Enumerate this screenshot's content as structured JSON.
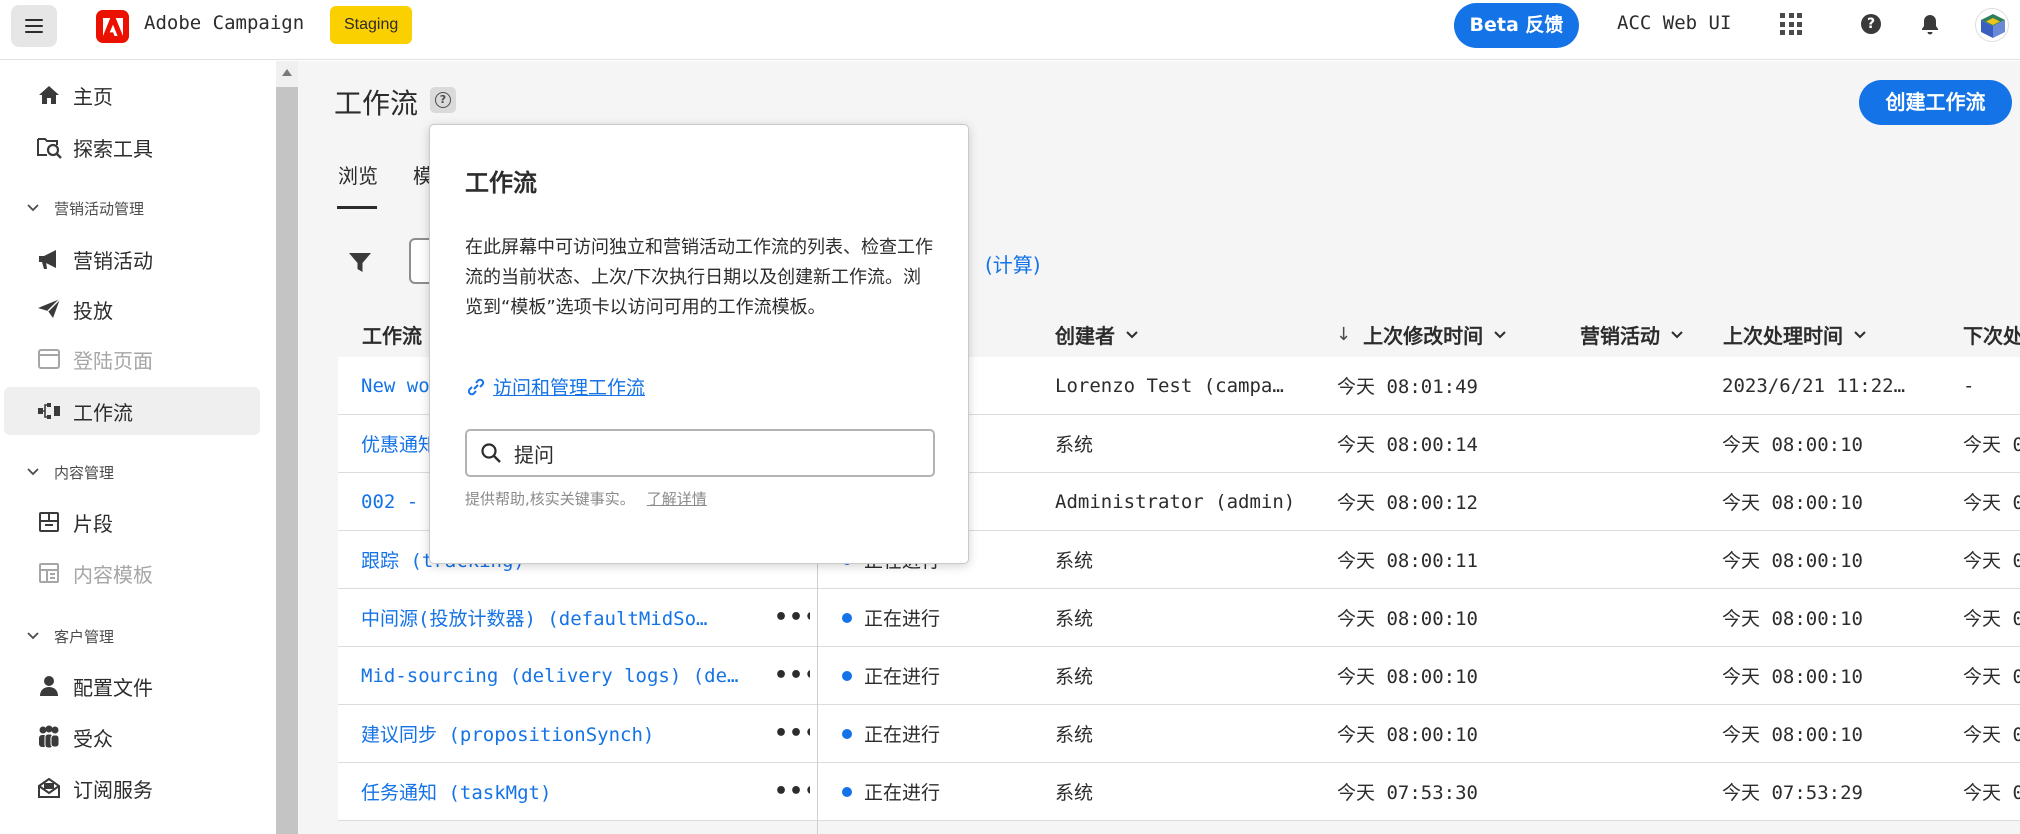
{
  "topbar": {
    "app_name": "Adobe Campaign",
    "env_badge": "Staging",
    "beta_label": "Beta 反馈",
    "org_name": "ACC Web UI",
    "help_glyph": "?"
  },
  "sidebar": {
    "items": [
      {
        "label": "主页",
        "icon": "home-icon"
      },
      {
        "label": "探索工具",
        "icon": "explorer-icon"
      },
      {
        "label": "营销活动",
        "icon": "megaphone-icon"
      },
      {
        "label": "投放",
        "icon": "send-icon"
      },
      {
        "label": "登陆页面",
        "icon": "landing-page-icon",
        "disabled": true
      },
      {
        "label": "工作流",
        "icon": "workflow-icon",
        "selected": true
      },
      {
        "label": "片段",
        "icon": "fragment-icon"
      },
      {
        "label": "内容模板",
        "icon": "content-template-icon",
        "disabled": true
      },
      {
        "label": "配置文件",
        "icon": "profile-icon"
      },
      {
        "label": "受众",
        "icon": "audience-icon"
      },
      {
        "label": "订阅服务",
        "icon": "subscription-icon"
      }
    ],
    "sections": [
      "营销活动管理",
      "内容管理",
      "客户管理"
    ]
  },
  "main": {
    "title": "工作流",
    "title_help_glyph": "?",
    "create_button": "创建工作流",
    "tabs": [
      "浏览",
      "模"
    ],
    "calc_link": "(计算)",
    "columns": {
      "name": "工作流",
      "creator": "创建者",
      "sort_arrow": "↓",
      "modified": "上次修改时间",
      "campaign": "营销活动",
      "processed": "上次处理时间",
      "next": "下次处"
    },
    "more_glyph": "•••",
    "rows": [
      {
        "name": "New wo",
        "status": "",
        "creator": "Lorenzo Test (campa…",
        "modified": "今天 08:01:49",
        "campaign": "",
        "processed": "2023/6/21 11:22…",
        "next": "-"
      },
      {
        "name": "优惠通知",
        "status": "",
        "creator": "系统",
        "modified": "今天 08:00:14",
        "campaign": "",
        "processed": "今天 08:00:10",
        "next": "今天 0"
      },
      {
        "name": "002 -",
        "status": "",
        "creator": "Administrator (admin)",
        "modified": "今天 08:00:12",
        "campaign": "",
        "processed": "今天 08:00:10",
        "next": "今天 0"
      },
      {
        "name": "跟踪 (tracking)",
        "status": "正在进行",
        "creator": "系统",
        "modified": "今天 08:00:11",
        "campaign": "",
        "processed": "今天 08:00:10",
        "next": "今天 0"
      },
      {
        "name": "中间源(投放计数器) (defaultMidSo…",
        "status": "正在进行",
        "creator": "系统",
        "modified": "今天 08:00:10",
        "campaign": "",
        "processed": "今天 08:00:10",
        "next": "今天 0"
      },
      {
        "name": "Mid-sourcing (delivery logs) (de…",
        "status": "正在进行",
        "creator": "系统",
        "modified": "今天 08:00:10",
        "campaign": "",
        "processed": "今天 08:00:10",
        "next": "今天 0"
      },
      {
        "name": "建议同步 (propositionSynch)",
        "status": "正在进行",
        "creator": "系统",
        "modified": "今天 08:00:10",
        "campaign": "",
        "processed": "今天 08:00:10",
        "next": "今天 0"
      },
      {
        "name": "任务通知 (taskMgt)",
        "status": "正在进行",
        "creator": "系统",
        "modified": "今天 07:53:30",
        "campaign": "",
        "processed": "今天 07:53:29",
        "next": "今天 0"
      }
    ]
  },
  "popover": {
    "title": "工作流",
    "description": "在此屏幕中可访问独立和营销活动工作流的列表、检查工作流的当前状态、上次/下次执行日期以及创建新工作流。浏览到“模板”选项卡以访问可用的工作流模板。",
    "link": "访问和管理工作流",
    "ask_placeholder": "提问",
    "hint": "提供帮助,核实关键事实。",
    "learn_more": "了解详情"
  },
  "colors": {
    "accent": "#1473e6",
    "staging": "#fad000",
    "adobe_red": "#eb1000"
  }
}
